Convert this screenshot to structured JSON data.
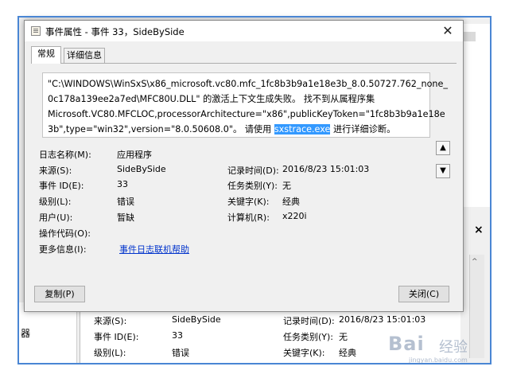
{
  "dialog": {
    "title": "事件属性 - 事件 33，SideBySide",
    "close_glyph": "✕",
    "tabs": [
      {
        "label": "常规",
        "active": true
      },
      {
        "label": "详细信息",
        "active": false
      }
    ],
    "description": {
      "line1": "\"C:\\WINDOWS\\WinSxS\\x86_microsoft.vc80.mfc_1fc8b3b9a1e18e3b_8.0.50727.762_none_",
      "line2": "0c178a139ee2a7ed\\MFC80U.DLL\" 的激活上下文生成失败。 找不到从属程序集",
      "line3": "Microsoft.VC80.MFCLOC,processorArchitecture=\"x86\",publicKeyToken=\"1fc8b3b9a1e18e",
      "line4_before": "3b\",type=\"win32\",version=\"8.0.50608.0\"。 请使用 ",
      "line4_highlight": "sxstrace.exe",
      "line4_after": " 进行详细诊断。"
    },
    "scroll_up_glyph": "▲",
    "scroll_down_glyph": "▼",
    "fields": {
      "log_name_label": "日志名称(M):",
      "log_name_value": "应用程序",
      "source_label": "来源(S):",
      "source_value": "SideBySide",
      "logged_label": "记录时间(D):",
      "logged_value": "2016/8/23 15:01:03",
      "event_id_label": "事件 ID(E):",
      "event_id_value": "33",
      "task_category_label": "任务类别(Y):",
      "task_category_value": "无",
      "level_label": "级别(L):",
      "level_value": "错误",
      "keywords_label": "关键字(K):",
      "keywords_value": "经典",
      "user_label": "用户(U):",
      "user_value": "暂缺",
      "computer_label": "计算机(R):",
      "computer_value": "x220i",
      "opcode_label": "操作代码(O):",
      "more_info_label": "更多信息(I):",
      "more_info_link": "事件日志联机帮助"
    },
    "copy_button": "复制(P)",
    "close_button": "关闭(C)"
  },
  "background_window": {
    "close_glyph": "×",
    "scroll_up_glyph": "^",
    "left_char": "器",
    "rows": {
      "source_label": "来源(S):",
      "source_value": "SideBySide",
      "logged_label": "记录时间(D):",
      "logged_value": "2016/8/23 15:01:03",
      "event_id_label": "事件 ID(E):",
      "event_id_value": "33",
      "task_category_label": "任务类别(Y):",
      "task_category_value": "无",
      "level_label": "级别(L):",
      "level_value": "错误",
      "keywords_label": "关键字(K):",
      "keywords_value": "经典"
    }
  },
  "watermark": {
    "brand": "Bai",
    "suffix": "经验",
    "url": "jingyan.baidu.com"
  },
  "colors": {
    "frame_border": "#4a86d4",
    "highlight_bg": "#3399ff",
    "link": "#0033cc"
  }
}
